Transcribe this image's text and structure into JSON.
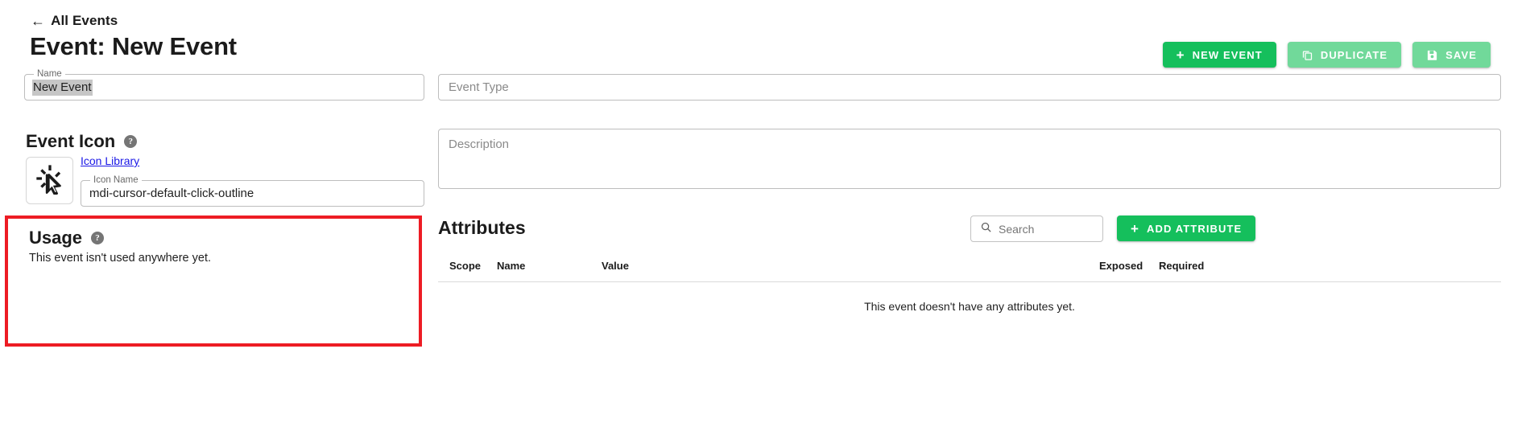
{
  "header": {
    "back_link": "All Events",
    "back_arrow_icon": "arrow-left-icon",
    "title": "Event: New Event",
    "actions": [
      {
        "label": "NEW EVENT",
        "icon": "plus-icon",
        "style": "primary"
      },
      {
        "label": "DUPLICATE",
        "icon": "copy-icon",
        "style": "muted"
      },
      {
        "label": "SAVE",
        "icon": "save-floppy-icon",
        "style": "muted"
      }
    ]
  },
  "form": {
    "name": {
      "legend": "Name",
      "value": "New Event",
      "selected": true
    },
    "event_type": {
      "legend": "",
      "placeholder": "Event Type",
      "value": ""
    },
    "description": {
      "legend": "",
      "placeholder": "Description",
      "value": ""
    }
  },
  "event_icon": {
    "heading": "Event Icon",
    "help_icon": "help-circle-icon",
    "preview_icon": "cursor-default-click-outline-icon",
    "library_link": "Icon Library",
    "icon_name": {
      "legend": "Icon Name",
      "value": "mdi-cursor-default-click-outline"
    }
  },
  "usage": {
    "heading": "Usage",
    "help_icon": "help-circle-icon",
    "empty_text": "This event isn't used anywhere yet.",
    "highlight_color": "#ed1c24"
  },
  "attributes": {
    "heading": "Attributes",
    "search": {
      "icon": "search-icon",
      "placeholder": "Search",
      "value": ""
    },
    "add_button": {
      "label": "ADD ATTRIBUTE",
      "icon": "plus-icon"
    },
    "columns": [
      "Scope",
      "Name",
      "Value",
      "Exposed",
      "Required"
    ],
    "rows": [],
    "empty_text": "This event doesn't have any attributes yet."
  },
  "colors": {
    "primary_green": "#15bf5c",
    "muted_green": "#71d99a",
    "link_blue": "#1a17e6",
    "highlight_red": "#ed1c24",
    "selection_grey": "#c6c6c6"
  }
}
